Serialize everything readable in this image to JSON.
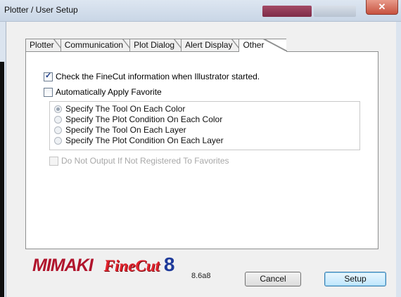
{
  "window": {
    "title": "Plotter / User Setup",
    "close_glyph": "✕"
  },
  "tabs": [
    {
      "label": "Plotter"
    },
    {
      "label": "Communication"
    },
    {
      "label": "Plot Dialog"
    },
    {
      "label": "Alert Display"
    },
    {
      "label": "Other"
    }
  ],
  "active_tab": "Other",
  "options": {
    "check_finecut": {
      "label": "Check the FineCut information when Illustrator started.",
      "checked": true
    },
    "auto_apply_favorite": {
      "label": "Automatically Apply Favorite",
      "checked": false
    },
    "radios": [
      {
        "label": "Specify The Tool On Each Color",
        "selected": true
      },
      {
        "label": "Specify The Plot Condition On Each Color",
        "selected": false
      },
      {
        "label": "Specify The Tool On Each Layer",
        "selected": false
      },
      {
        "label": "Specify The Plot Condition On Each Layer",
        "selected": false
      }
    ],
    "do_not_output": {
      "label": "Do Not Output If Not Registered To Favorites",
      "checked": false,
      "disabled": true
    }
  },
  "branding": {
    "mimaki": "MIMAKI",
    "finecut": "FineCut",
    "number": "8",
    "version": "8.6a8"
  },
  "buttons": {
    "cancel": "Cancel",
    "setup": "Setup"
  },
  "colors": {
    "mimaki_red": "#b0142c",
    "finecut_red": "#e2232d",
    "eight_blue": "#1e3a9a"
  }
}
